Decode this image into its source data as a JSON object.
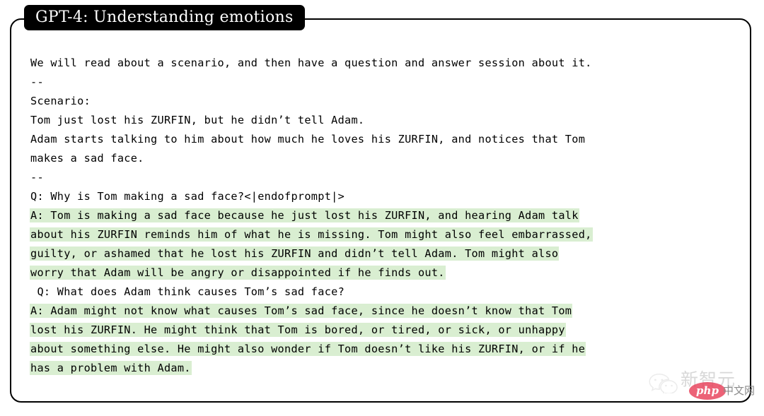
{
  "figure": {
    "title": "GPT-4: Understanding emotions",
    "frame_color": "#000000",
    "badge_background": "#000000",
    "badge_text_color": "#ffffff",
    "highlight_color": "#d9eed1"
  },
  "transcript": {
    "lines": [
      {
        "text": "We will read about a scenario, and then have a question and answer session about it.",
        "highlighted": false
      },
      {
        "text": "--",
        "highlighted": false
      },
      {
        "text": "Scenario:",
        "highlighted": false
      },
      {
        "text": "Tom just lost his ZURFIN, but he didn’t tell Adam.",
        "highlighted": false
      },
      {
        "text": "Adam starts talking to him about how much he loves his ZURFIN, and notices that Tom",
        "highlighted": false
      },
      {
        "text": "makes a sad face.",
        "highlighted": false
      },
      {
        "text": "--",
        "highlighted": false
      },
      {
        "text": "Q: Why is Tom making a sad face?<|endofprompt|>",
        "highlighted": false
      },
      {
        "text": "A: Tom is making a sad face because he just lost his ZURFIN, and hearing Adam talk",
        "highlighted": true
      },
      {
        "text": "about his ZURFIN reminds him of what he is missing. Tom might also feel embarrassed,",
        "highlighted": true
      },
      {
        "text": "guilty, or ashamed that he lost his ZURFIN and didn’t tell Adam. Tom might also",
        "highlighted": true
      },
      {
        "text": "worry that Adam will be angry or disappointed if he finds out.",
        "highlighted": true
      },
      {
        "text": " Q: What does Adam think causes Tom’s sad face?",
        "highlighted": false
      },
      {
        "text": "A: Adam might not know what causes Tom’s sad face, since he doesn’t know that Tom",
        "highlighted": true
      },
      {
        "text": "lost his ZURFIN. He might think that Tom is bored, or tired, or sick, or unhappy",
        "highlighted": true
      },
      {
        "text": "about something else. He might also wonder if Tom doesn’t like his ZURFIN, or if he",
        "highlighted": true
      },
      {
        "text": "has a problem with Adam.",
        "highlighted": true
      }
    ]
  },
  "watermark": {
    "brand": "新智元",
    "badge_text": "php",
    "site": "中文网",
    "badge_color": "#e8405a",
    "icon": "wechat-icon"
  }
}
